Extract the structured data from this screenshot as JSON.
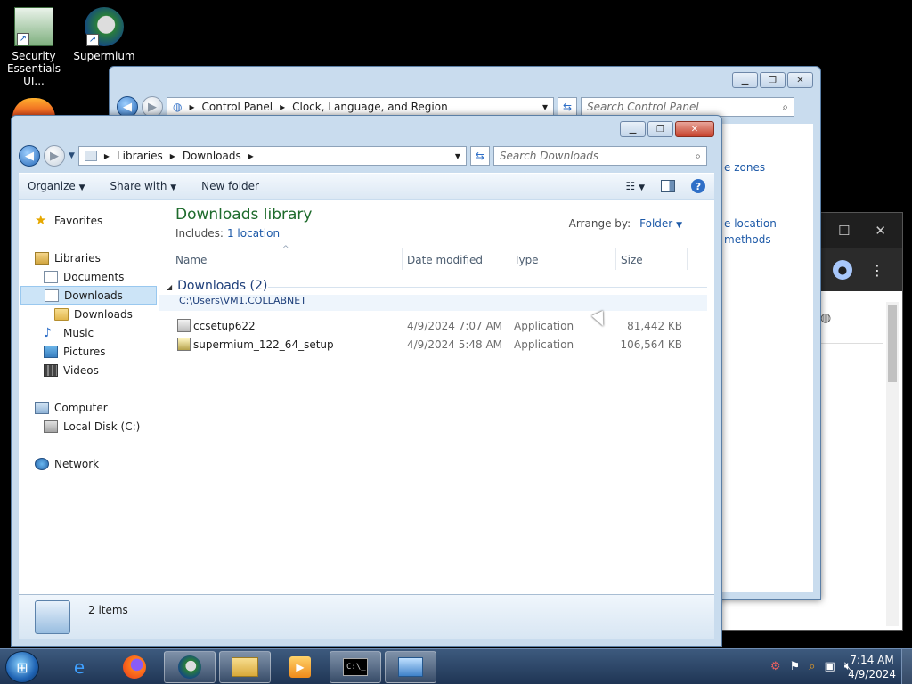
{
  "desktop": {
    "icons": [
      {
        "label": "Security Essentials UI...",
        "icon": "security-essentials-icon"
      },
      {
        "label": "Supermium",
        "icon": "supermium-icon"
      }
    ]
  },
  "control_panel": {
    "breadcrumb": [
      "Control Panel",
      "Clock, Language, and Region"
    ],
    "search_placeholder": "Search Control Panel",
    "visible_links": [
      "e zones",
      "e location",
      "methods"
    ]
  },
  "explorer": {
    "breadcrumb": [
      "Libraries",
      "Downloads"
    ],
    "search_placeholder": "Search Downloads",
    "toolbar": {
      "organize": "Organize",
      "share_with": "Share with",
      "new_folder": "New folder"
    },
    "nav": {
      "favorites": "Favorites",
      "libraries": "Libraries",
      "documents": "Documents",
      "downloads": "Downloads",
      "downloads_sub": "Downloads",
      "music": "Music",
      "pictures": "Pictures",
      "videos": "Videos",
      "computer": "Computer",
      "local_disk": "Local Disk (C:)",
      "network": "Network"
    },
    "library": {
      "title": "Downloads library",
      "includes_label": "Includes:",
      "includes_link": "1 location",
      "arrange_label": "Arrange by:",
      "arrange_value": "Folder"
    },
    "columns": {
      "name": "Name",
      "date": "Date modified",
      "type": "Type",
      "size": "Size"
    },
    "group": {
      "name": "Downloads (2)",
      "path": "C:\\Users\\VM1.COLLABNET"
    },
    "files": [
      {
        "name": "ccsetup622",
        "date": "4/9/2024 7:07 AM",
        "type": "Application",
        "size": "81,442 KB"
      },
      {
        "name": "supermium_122_64_setup",
        "date": "4/9/2024 5:48 AM",
        "type": "Application",
        "size": "106,564 KB"
      }
    ],
    "details": {
      "count": "2 items"
    }
  },
  "taskbar": {
    "time": "7:14 AM",
    "date": "4/9/2024"
  }
}
